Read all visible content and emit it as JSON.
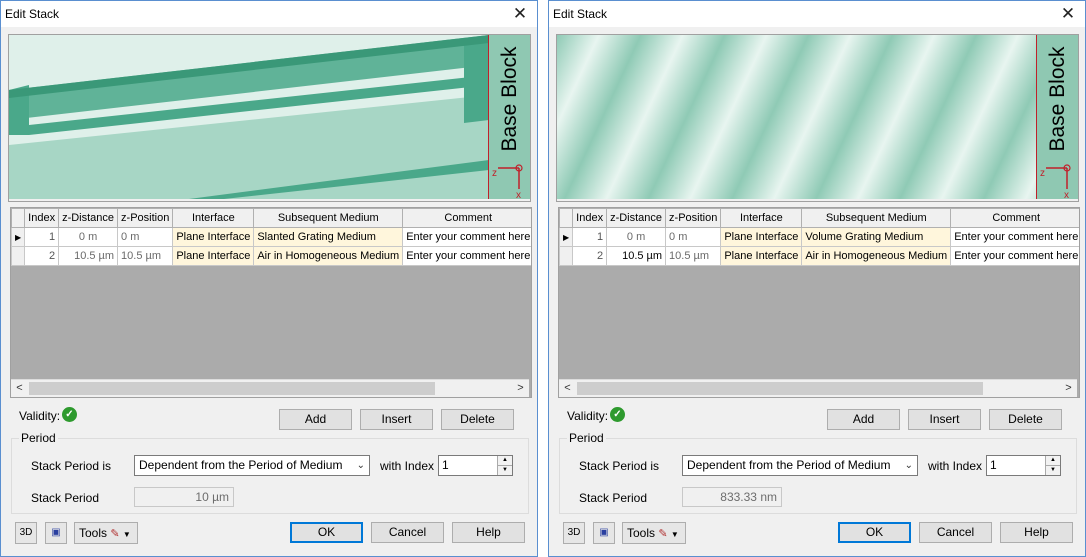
{
  "dialogs": [
    {
      "title": "Edit Stack",
      "close_glyph": "✕",
      "base_block_label": "Base Block",
      "axis_z": "z",
      "axis_x": "x",
      "preview_style": "slanted",
      "columns": [
        "Index",
        "z-Distance",
        "z-Position",
        "Interface",
        "Subsequent Medium",
        "Comment"
      ],
      "rows": [
        {
          "index": "1",
          "z_distance": "0 m",
          "z_position": "0 m",
          "interface": "Plane Interface",
          "medium": "Slanted Grating Medium",
          "comment": "Enter your comment here"
        },
        {
          "index": "2",
          "z_distance": "10.5 µm",
          "z_position": "10.5 µm",
          "interface": "Plane Interface",
          "medium": "Air in Homogeneous Medium",
          "comment": "Enter your comment here"
        }
      ],
      "validity_label": "Validity:",
      "validity_icon": "check-icon",
      "buttons": {
        "add": "Add",
        "insert": "Insert",
        "delete": "Delete",
        "ok": "OK",
        "cancel": "Cancel",
        "help": "Help"
      },
      "period_group_label": "Period",
      "stack_period_is_label": "Stack Period is",
      "stack_period_is_value": "Dependent from the Period of Medium",
      "with_index_label": "with Index",
      "with_index_value": "1",
      "stack_period_label": "Stack Period",
      "stack_period_value": "10 µm",
      "tools_label": "Tools"
    },
    {
      "title": "Edit Stack",
      "close_glyph": "✕",
      "base_block_label": "Base Block",
      "axis_z": "z",
      "axis_x": "x",
      "preview_style": "volume",
      "columns": [
        "Index",
        "z-Distance",
        "z-Position",
        "Interface",
        "Subsequent Medium",
        "Comment"
      ],
      "rows": [
        {
          "index": "1",
          "z_distance": "0 m",
          "z_position": "0 m",
          "interface": "Plane Interface",
          "medium": "Volume Grating Medium",
          "comment": "Enter your comment here"
        },
        {
          "index": "2",
          "z_distance": "10.5 µm",
          "z_position": "10.5 µm",
          "interface": "Plane Interface",
          "medium": "Air in Homogeneous Medium",
          "comment": "Enter your comment here"
        }
      ],
      "validity_label": "Validity:",
      "validity_icon": "check-icon",
      "buttons": {
        "add": "Add",
        "insert": "Insert",
        "delete": "Delete",
        "ok": "OK",
        "cancel": "Cancel",
        "help": "Help"
      },
      "period_group_label": "Period",
      "stack_period_is_label": "Stack Period is",
      "stack_period_is_value": "Dependent from the Period of Medium",
      "with_index_label": "with Index",
      "with_index_value": "1",
      "stack_period_label": "Stack Period",
      "stack_period_value": "833.33 nm",
      "tools_label": "Tools"
    }
  ],
  "colors": {
    "grating_light": "#dff0ea",
    "grating_dark": "#4aa88a",
    "base_block": "#8fc8b2",
    "axis_red": "#c0202a",
    "ok_border": "#0078d7",
    "valid_green": "#2e9a2e"
  }
}
